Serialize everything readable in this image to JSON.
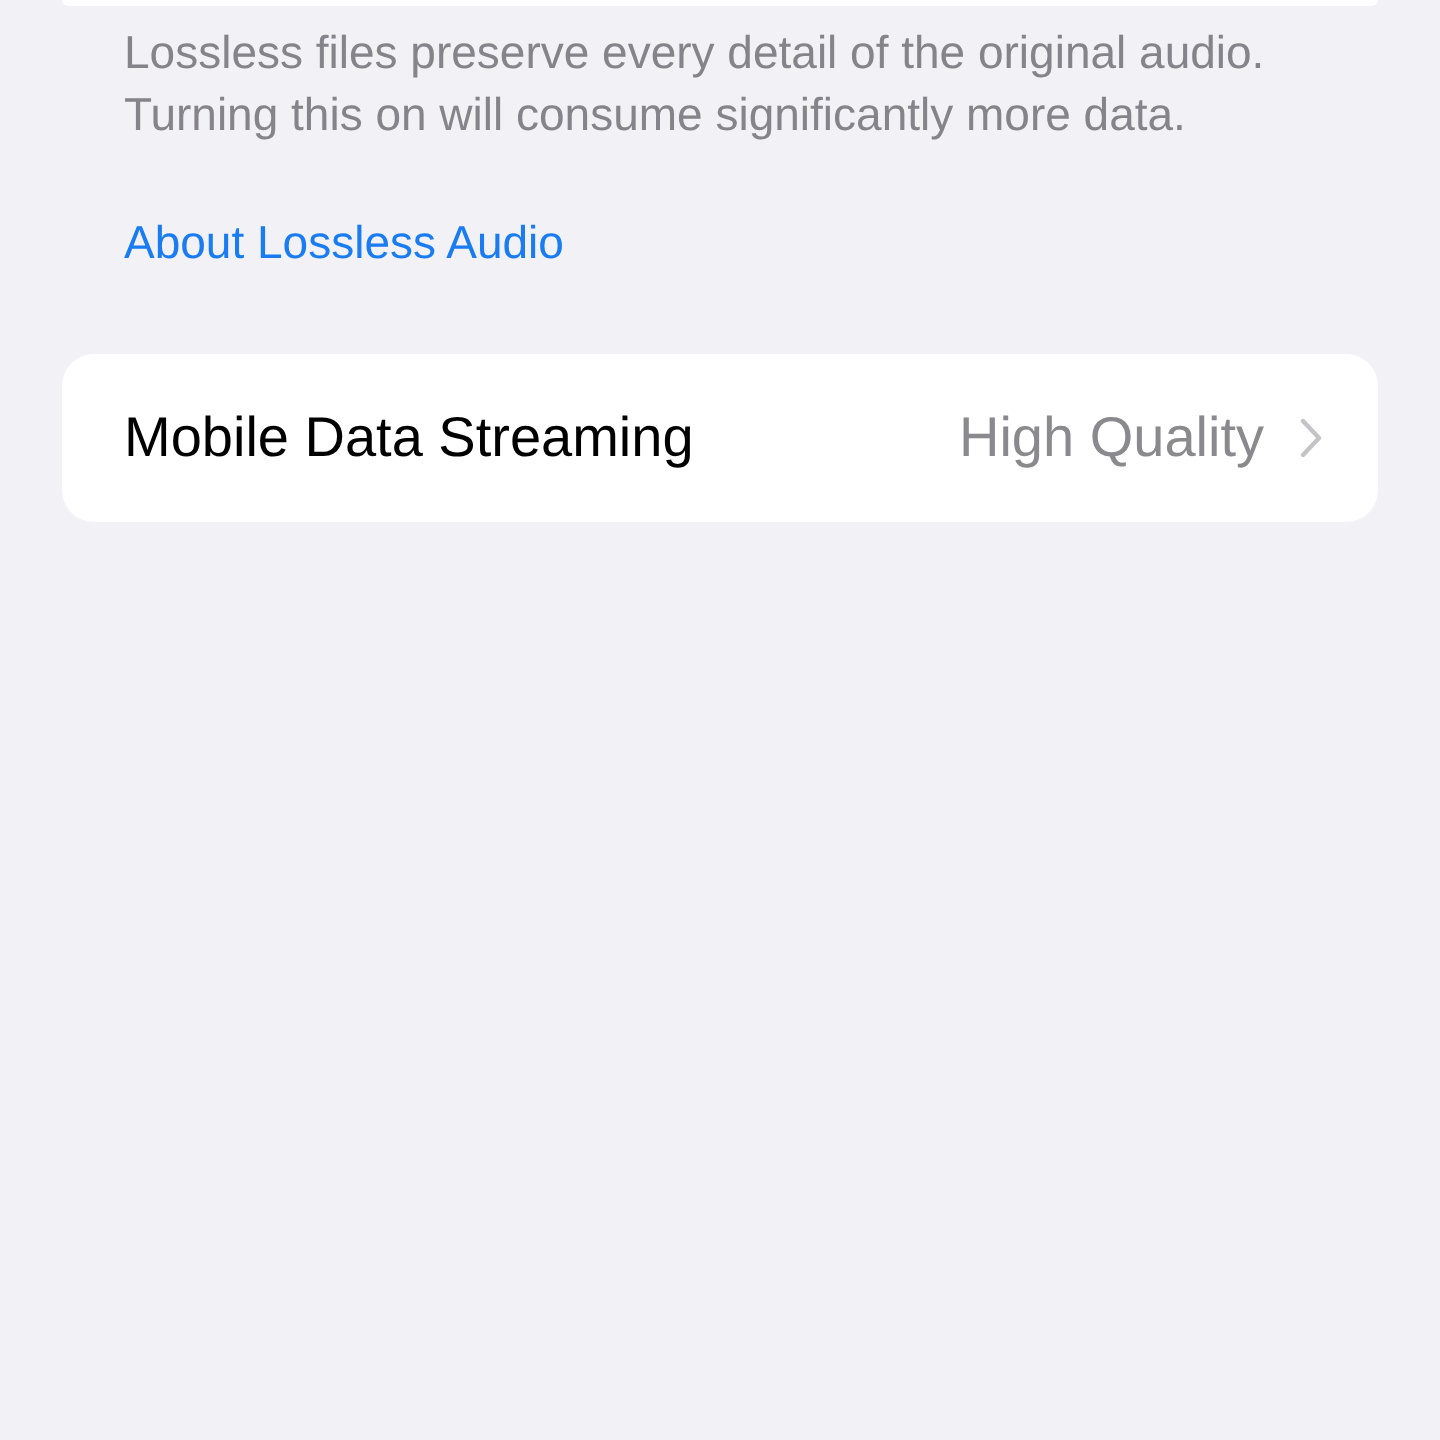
{
  "footer": {
    "text": "Lossless files preserve every detail of the original audio. Turning this on will consume significantly more data.",
    "link": "About Lossless Audio"
  },
  "rows": [
    {
      "label": "Mobile Data Streaming",
      "value": "High Quality"
    }
  ]
}
